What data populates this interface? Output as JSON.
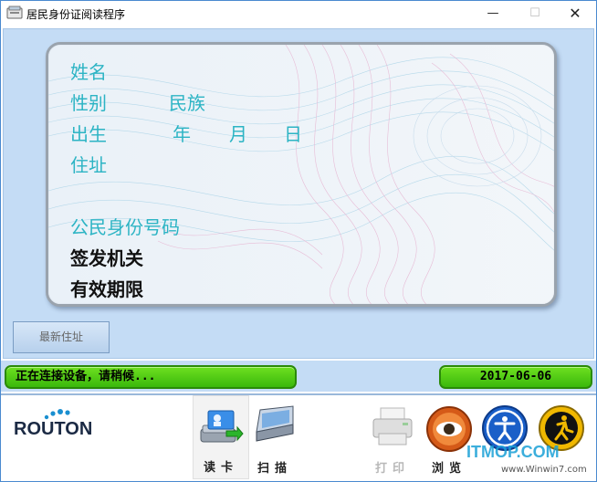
{
  "window": {
    "title": "居民身份证阅读程序",
    "minimize_glyph": "—",
    "maximize_glyph": "☐",
    "close_glyph": "✕"
  },
  "card": {
    "name_label": "姓名",
    "gender_label": "性别",
    "ethnicity_label": "民族",
    "birth_label": "出生",
    "year_label": "年",
    "month_label": "月",
    "day_label": "日",
    "address_label": "住址",
    "id_number_label": "公民身份号码",
    "issuer_label": "签发机关",
    "validity_label": "有效期限"
  },
  "buttons": {
    "new_address": "最新住址"
  },
  "status": {
    "message": "正在连接设备，请稍候...",
    "date": "2017-06-06"
  },
  "toolbar": {
    "logo_text": "ROUTON",
    "read_card": "读卡",
    "scan": "扫描",
    "print": "打印",
    "browse": "浏览",
    "watermark": "ITMOP.COM",
    "watermark_sub": "www.Winwin7.com"
  },
  "colors": {
    "label_cyan": "#2cb4c4",
    "status_green": "#4ccb14",
    "main_blue": "#c4dcf5"
  },
  "icons": [
    "app-icon",
    "card-reader-icon",
    "scanner-icon",
    "printer-icon",
    "browse-icon",
    "accessibility-icon",
    "exit-icon"
  ]
}
